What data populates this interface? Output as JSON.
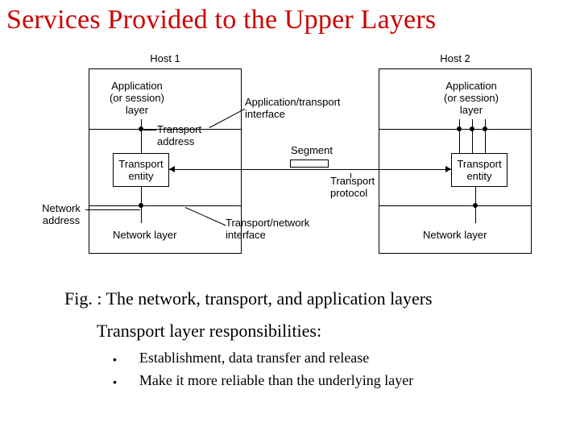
{
  "title": "Services Provided to the Upper Layers",
  "hosts": {
    "h1": "Host 1",
    "h2": "Host 2"
  },
  "layers": {
    "app": "Application\n(or session)\nlayer",
    "entity": "Transport\nentity",
    "netlayer": "Network layer"
  },
  "labels": {
    "transport_address": "Transport\naddress",
    "app_transport_if": "Application/transport\ninterface",
    "segment": "Segment",
    "transport_protocol": "Transport\nprotocol",
    "network_address": "Network\naddress",
    "transport_network_if": "Transport/network\ninterface"
  },
  "caption": "Fig. : The network, transport, and application layers",
  "resp_head": "Transport layer responsibilities:",
  "bullet1": "Establishment, data transfer and release",
  "bullet2": "Make it more reliable than the underlying layer"
}
